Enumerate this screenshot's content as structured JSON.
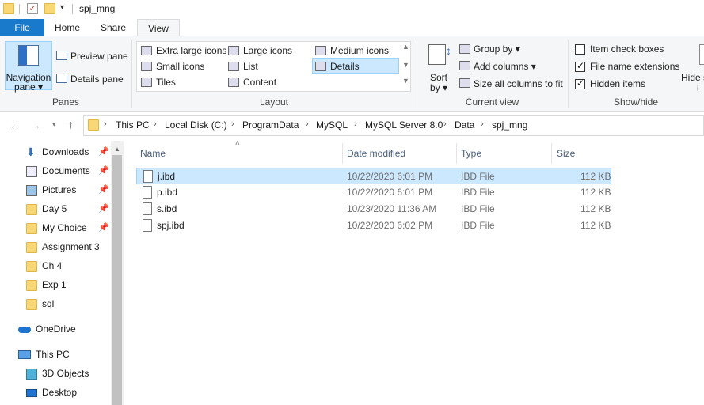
{
  "window": {
    "title": "spj_mng"
  },
  "tabs": [
    {
      "label": "File"
    },
    {
      "label": "Home"
    },
    {
      "label": "Share"
    },
    {
      "label": "View"
    }
  ],
  "ribbon": {
    "panes": {
      "navigation_pane_line1": "Navigation",
      "navigation_pane_line2": "pane ▾",
      "preview_pane": "Preview pane",
      "details_pane": "Details pane",
      "group_label": "Panes"
    },
    "layout": {
      "items": [
        {
          "label": "Extra large icons"
        },
        {
          "label": "Large icons"
        },
        {
          "label": "Medium icons"
        },
        {
          "label": "Small icons"
        },
        {
          "label": "List"
        },
        {
          "label": "Details"
        },
        {
          "label": "Tiles"
        },
        {
          "label": "Content"
        }
      ],
      "group_label": "Layout"
    },
    "current_view": {
      "sort_line1": "Sort",
      "sort_line2": "by ▾",
      "group_by": "Group by ▾",
      "add_columns": "Add columns ▾",
      "size_all_columns": "Size all columns to fit",
      "group_label": "Current view"
    },
    "show_hide": {
      "item_check_boxes": "Item check boxes",
      "file_name_extensions": "File name extensions",
      "hidden_items": "Hidden items",
      "item_check_boxes_checked": false,
      "file_name_extensions_checked": true,
      "hidden_items_checked": true,
      "hide_selected_line1": "Hide s",
      "hide_selected_line2": "i",
      "group_label": "Show/hide"
    }
  },
  "address": {
    "breadcrumbs": [
      "This PC",
      "Local Disk (C:)",
      "ProgramData",
      "MySQL",
      "MySQL Server 8.0",
      "Data",
      "spj_mng"
    ]
  },
  "sidebar": {
    "items": [
      {
        "label": "Downloads",
        "icon": "download-icon",
        "pinned": true
      },
      {
        "label": "Documents",
        "icon": "documents-icon",
        "pinned": true
      },
      {
        "label": "Pictures",
        "icon": "pictures-icon",
        "pinned": true
      },
      {
        "label": "Day 5",
        "icon": "folder-icon",
        "pinned": true
      },
      {
        "label": "My Choice",
        "icon": "folder-icon",
        "pinned": true
      },
      {
        "label": "Assignment 3",
        "icon": "folder-icon",
        "pinned": false
      },
      {
        "label": "Ch 4",
        "icon": "folder-icon",
        "pinned": false
      },
      {
        "label": "Exp 1",
        "icon": "folder-icon",
        "pinned": false
      },
      {
        "label": "sql",
        "icon": "folder-icon",
        "pinned": false
      },
      {
        "label": "OneDrive",
        "icon": "onedrive-icon",
        "pinned": false
      },
      {
        "label": "This PC",
        "icon": "pc-icon",
        "pinned": false
      },
      {
        "label": "3D Objects",
        "icon": "3d-objects-icon",
        "pinned": false
      },
      {
        "label": "Desktop",
        "icon": "desktop-icon",
        "pinned": false
      }
    ]
  },
  "file_list": {
    "columns": [
      "Name",
      "Date modified",
      "Type",
      "Size"
    ],
    "rows": [
      {
        "name": "j.ibd",
        "date": "10/22/2020 6:01 PM",
        "type": "IBD File",
        "size": "112 KB",
        "selected": true
      },
      {
        "name": "p.ibd",
        "date": "10/22/2020 6:01 PM",
        "type": "IBD File",
        "size": "112 KB",
        "selected": false
      },
      {
        "name": "s.ibd",
        "date": "10/23/2020 11:36 AM",
        "type": "IBD File",
        "size": "112 KB",
        "selected": false
      },
      {
        "name": "spj.ibd",
        "date": "10/22/2020 6:02 PM",
        "type": "IBD File",
        "size": "112 KB",
        "selected": false
      }
    ]
  },
  "colors": {
    "file_tab": "#1979ca",
    "selection_bg": "#cce8ff",
    "selection_border": "#99d1ff",
    "folder": "#f8d774"
  }
}
